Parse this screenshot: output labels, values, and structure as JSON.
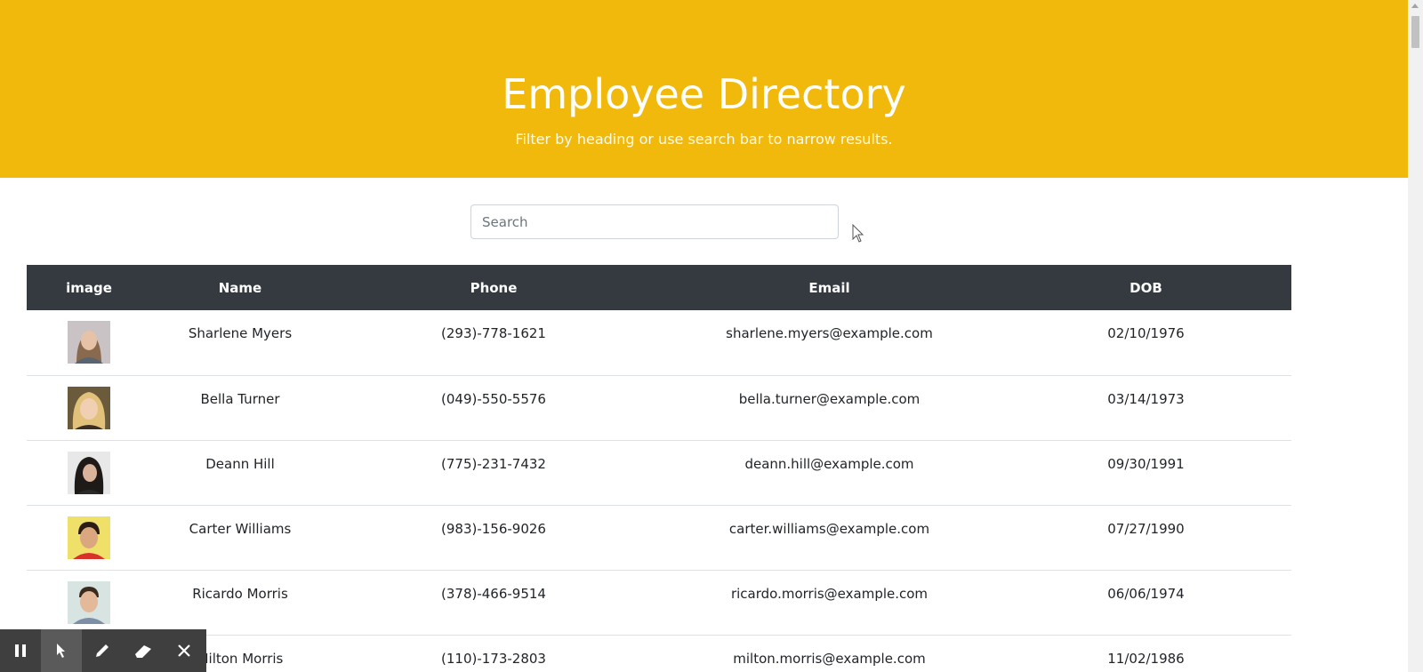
{
  "header": {
    "title": "Employee Directory",
    "subtitle": "Filter by heading or use search bar to narrow results."
  },
  "search": {
    "placeholder": "Search",
    "value": ""
  },
  "table": {
    "columns": [
      "image",
      "Name",
      "Phone",
      "Email",
      "DOB"
    ],
    "rows": [
      {
        "name": "Sharlene Myers",
        "phone": "(293)-778-1621",
        "email": "sharlene.myers@example.com",
        "dob": "02/10/1976"
      },
      {
        "name": "Bella Turner",
        "phone": "(049)-550-5576",
        "email": "bella.turner@example.com",
        "dob": "03/14/1973"
      },
      {
        "name": "Deann Hill",
        "phone": "(775)-231-7432",
        "email": "deann.hill@example.com",
        "dob": "09/30/1991"
      },
      {
        "name": "Carter Williams",
        "phone": "(983)-156-9026",
        "email": "carter.williams@example.com",
        "dob": "07/27/1990"
      },
      {
        "name": "Ricardo Morris",
        "phone": "(378)-466-9514",
        "email": "ricardo.morris@example.com",
        "dob": "06/06/1974"
      },
      {
        "name": "Milton Morris",
        "phone": "(110)-173-2803",
        "email": "milton.morris@example.com",
        "dob": "11/02/1986"
      }
    ]
  },
  "toolbar": {
    "buttons": [
      {
        "icon": "pause-icon"
      },
      {
        "icon": "pointer-icon",
        "active": true
      },
      {
        "icon": "pen-icon"
      },
      {
        "icon": "eraser-icon"
      },
      {
        "icon": "close-icon"
      }
    ]
  },
  "colors": {
    "header_bg": "#f0b90b",
    "table_head_bg": "#343a40",
    "toolbar_bg": "#3f3f3f"
  }
}
